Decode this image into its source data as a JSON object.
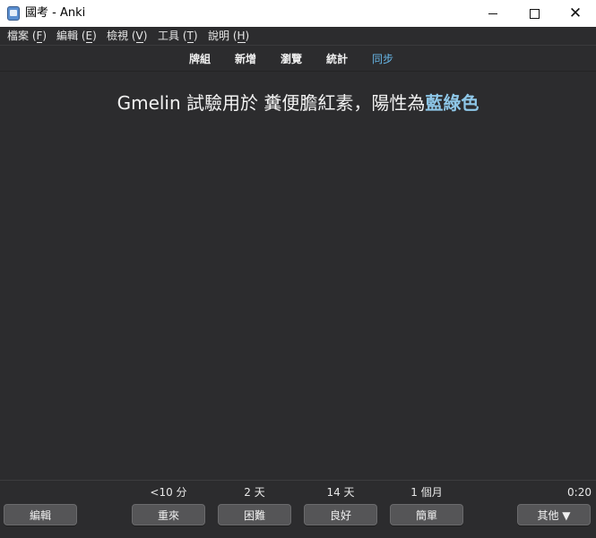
{
  "window": {
    "title": "國考 - Anki",
    "icons": [
      "anki-icon",
      "minimize-icon",
      "maximize-icon",
      "close-icon"
    ]
  },
  "menu": {
    "items": [
      {
        "label": "檔案 (",
        "key": "F",
        "suffix": ")"
      },
      {
        "label": "編輯 (",
        "key": "E",
        "suffix": ")"
      },
      {
        "label": "檢視 (",
        "key": "V",
        "suffix": ")"
      },
      {
        "label": "工具 (",
        "key": "T",
        "suffix": ")"
      },
      {
        "label": "說明 (",
        "key": "H",
        "suffix": ")"
      }
    ]
  },
  "toolbar": {
    "decks": "牌組",
    "add": "新增",
    "browse": "瀏覽",
    "stats": "統計",
    "sync": "同步"
  },
  "card": {
    "text_before": "Gmelin 試驗用於 糞便膽紅素，陽性為",
    "text_highlight": "藍綠色"
  },
  "bottom": {
    "edit": "編輯",
    "more": "其他 ▼",
    "timer": "0:20",
    "answers": [
      {
        "label": "重來",
        "interval": "<10 分"
      },
      {
        "label": "困難",
        "interval": "2 天"
      },
      {
        "label": "良好",
        "interval": "14 天"
      },
      {
        "label": "簡單",
        "interval": "1 個月"
      }
    ]
  },
  "colors": {
    "background": "#2c2c2e",
    "sync_link": "#67b7e8",
    "highlight": "#8ec7e8",
    "button": "#555557"
  }
}
